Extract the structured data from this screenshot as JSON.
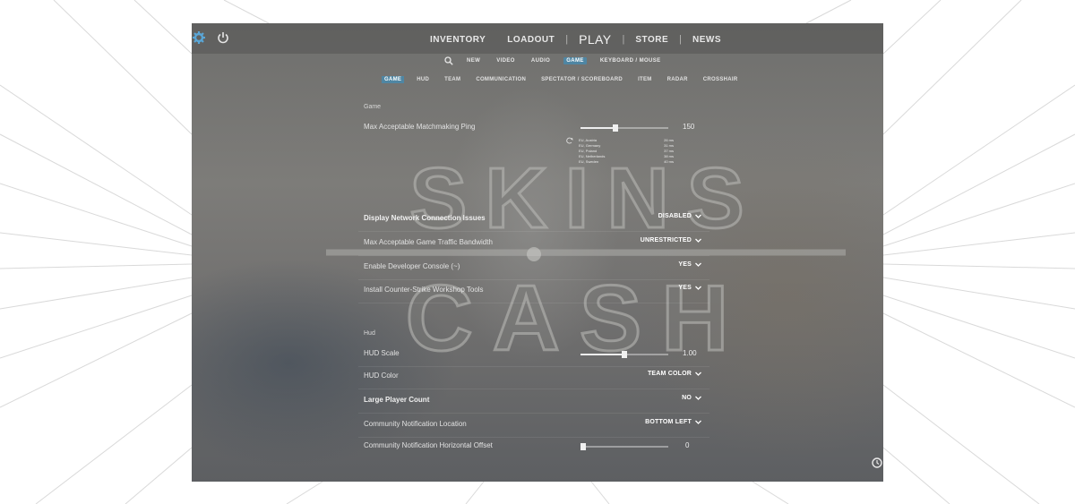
{
  "watermark": {
    "line1": "SKINS",
    "line2": "CASH"
  },
  "top_nav": {
    "settings_icon": "gear-icon",
    "power_icon": "power-icon",
    "tabs": [
      {
        "label": "INVENTORY",
        "active": false
      },
      {
        "label": "LOADOUT",
        "active": false
      },
      {
        "label": "PLAY",
        "active": true
      },
      {
        "label": "STORE",
        "active": false
      },
      {
        "label": "NEWS",
        "active": false
      }
    ]
  },
  "sub_nav": {
    "search_icon": "search-icon",
    "tabs": [
      {
        "label": "NEW",
        "active": false
      },
      {
        "label": "VIDEO",
        "active": false
      },
      {
        "label": "AUDIO",
        "active": false
      },
      {
        "label": "GAME",
        "active": true
      },
      {
        "label": "KEYBOARD / MOUSE",
        "active": false
      }
    ]
  },
  "game_tabs": [
    {
      "label": "GAME",
      "active": true
    },
    {
      "label": "HUD",
      "active": false
    },
    {
      "label": "TEAM",
      "active": false
    },
    {
      "label": "COMMUNICATION",
      "active": false
    },
    {
      "label": "SPECTATOR / SCOREBOARD",
      "active": false
    },
    {
      "label": "ITEM",
      "active": false
    },
    {
      "label": "RADAR",
      "active": false
    },
    {
      "label": "CROSSHAIR",
      "active": false
    }
  ],
  "sections": {
    "game": {
      "header": "Game",
      "ping": {
        "label": "Max Acceptable Matchmaking Ping",
        "value": "150",
        "fraction": 0.4
      },
      "servers": [
        {
          "name": "EU, Austria",
          "ping": "26 ms"
        },
        {
          "name": "EU, Germany",
          "ping": "31 ms"
        },
        {
          "name": "EU, Poland",
          "ping": "37 ms"
        },
        {
          "name": "EU, Netherlands",
          "ping": "38 ms"
        },
        {
          "name": "EU, Sweden",
          "ping": "40 ms"
        }
      ],
      "rows": [
        {
          "label": "Display Network Connection Issues",
          "value": "DISABLED",
          "bold": true
        },
        {
          "label": "Max Acceptable Game Traffic Bandwidth",
          "value": "UNRESTRICTED",
          "bold": false
        },
        {
          "label": "Enable Developer Console (~)",
          "value": "YES",
          "bold": false
        },
        {
          "label": "Install Counter-Strike Workshop Tools",
          "value": "YES",
          "bold": false
        }
      ]
    },
    "hud": {
      "header": "Hud",
      "scale": {
        "label": "HUD Scale",
        "value": "1.00",
        "fraction": 0.5
      },
      "rows": [
        {
          "label": "HUD Color",
          "value": "TEAM COLOR",
          "bold": false
        },
        {
          "label": "Large Player Count",
          "value": "NO",
          "bold": true
        },
        {
          "label": "Community Notification Location",
          "value": "BOTTOM LEFT",
          "bold": false
        }
      ],
      "offset": {
        "label": "Community Notification Horizontal Offset",
        "value": "0",
        "fraction": 0.0
      }
    }
  },
  "colors": {
    "accent": "#4f86a3",
    "text": "#e2e2e2",
    "background": "#767573"
  }
}
